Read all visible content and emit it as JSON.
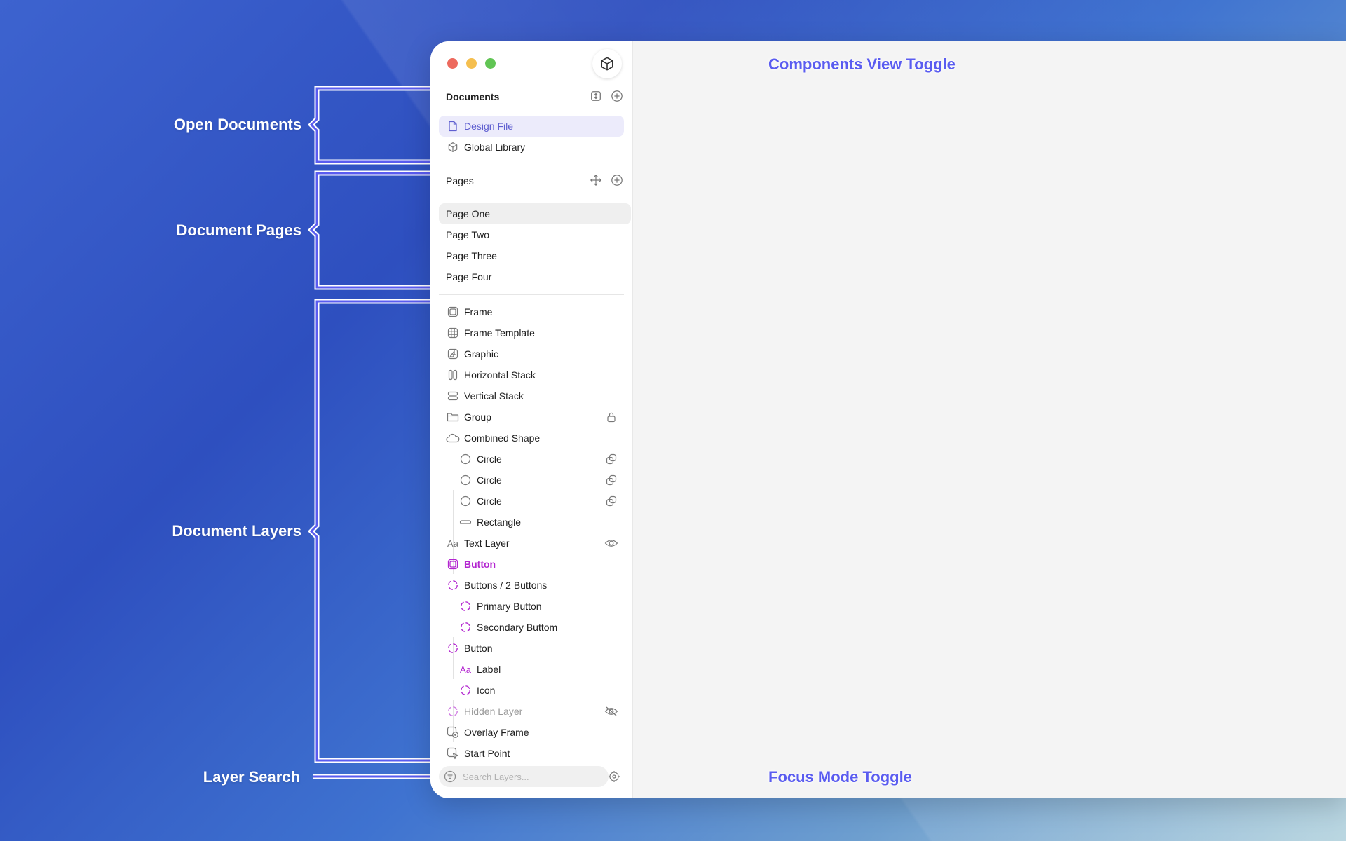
{
  "annotations": {
    "open_documents": "Open Documents",
    "document_pages": "Document Pages",
    "document_layers": "Document Layers",
    "layer_search": "Layer Search",
    "components_view_toggle": "Components View Toggle",
    "focus_mode_toggle": "Focus Mode Toggle"
  },
  "sidebar": {
    "documents_title": "Documents",
    "documents": [
      {
        "label": "Design File",
        "icon": "document-icon",
        "selected": true
      },
      {
        "label": "Global Library",
        "icon": "cube-icon",
        "selected": false
      }
    ],
    "pages_title": "Pages",
    "pages": [
      {
        "label": "Page One",
        "selected": true
      },
      {
        "label": "Page Two"
      },
      {
        "label": "Page Three"
      },
      {
        "label": "Page Four"
      }
    ],
    "layers": [
      {
        "label": "Frame",
        "icon": "frame-icon"
      },
      {
        "label": "Frame Template",
        "icon": "grid-icon"
      },
      {
        "label": "Graphic",
        "icon": "graphic-icon"
      },
      {
        "label": "Horizontal Stack",
        "icon": "horizontal-stack-icon"
      },
      {
        "label": "Vertical Stack",
        "icon": "vertical-stack-icon"
      },
      {
        "label": "Group",
        "icon": "folder-icon",
        "tail": "lock-icon"
      },
      {
        "label": "Combined Shape",
        "icon": "cloud-icon"
      },
      {
        "label": "Circle",
        "icon": "circle-icon",
        "child": true,
        "tail": "mask-icon"
      },
      {
        "label": "Circle",
        "icon": "circle-icon",
        "child": true,
        "tail": "mask-icon"
      },
      {
        "label": "Circle",
        "icon": "circle-icon",
        "child": true,
        "tail": "mask-icon"
      },
      {
        "label": "Rectangle",
        "icon": "rectangle-icon",
        "child": true
      },
      {
        "label": "Text Layer",
        "icon": "text-icon",
        "tail": "eye-icon"
      },
      {
        "label": "Button",
        "icon": "component-icon",
        "style": "purple"
      },
      {
        "label": "Buttons / 2 Buttons",
        "icon": "instance-icon"
      },
      {
        "label": "Primary Button",
        "icon": "instance-icon",
        "child": true
      },
      {
        "label": "Secondary Buttom",
        "icon": "instance-icon",
        "child": true
      },
      {
        "label": "Button",
        "icon": "instance-icon"
      },
      {
        "label": "Label",
        "icon": "text-icon-purple",
        "child": true
      },
      {
        "label": "Icon",
        "icon": "instance-icon",
        "child": true
      },
      {
        "label": "Hidden Layer",
        "icon": "instance-icon",
        "style": "muted",
        "tail": "eye-off-icon"
      },
      {
        "label": "Overlay Frame",
        "icon": "overlay-frame-icon"
      },
      {
        "label": "Start Point",
        "icon": "start-point-icon"
      }
    ],
    "search_placeholder": "Search Layers..."
  },
  "colors": {
    "accent": "#5a5cf0",
    "component": "#b326d0",
    "selected_doc_bg": "#ecebfb"
  }
}
